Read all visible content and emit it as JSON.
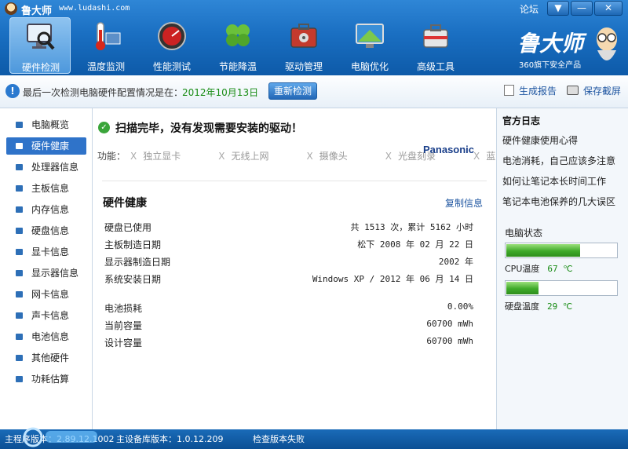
{
  "titlebar": {
    "title": "鲁大师",
    "url": "www.ludashi.com",
    "forum": "论坛",
    "menu_glyph": "▼",
    "min_glyph": "—",
    "close_glyph": "✕"
  },
  "nav": [
    {
      "label": "硬件检测",
      "icon": "monitor-magnifier-icon"
    },
    {
      "label": "温度监测",
      "icon": "thermometer-icon"
    },
    {
      "label": "性能测试",
      "icon": "speedometer-icon"
    },
    {
      "label": "节能降温",
      "icon": "clover-icon"
    },
    {
      "label": "驱动管理",
      "icon": "toolbox-icon"
    },
    {
      "label": "电脑优化",
      "icon": "screen-optimize-icon"
    },
    {
      "label": "高级工具",
      "icon": "toolkit-icon"
    }
  ],
  "brand": {
    "name": "鲁大师",
    "sub": "360旗下安全产品"
  },
  "infobar": {
    "text": "最后一次检测电脑硬件配置情况是在：",
    "date": "2012年10月13日",
    "recheck": "重新检测",
    "report": "生成报告",
    "screenshot": "保存截屏"
  },
  "sidebar": [
    {
      "label": "电脑概览"
    },
    {
      "label": "硬件健康"
    },
    {
      "label": "处理器信息"
    },
    {
      "label": "主板信息"
    },
    {
      "label": "内存信息"
    },
    {
      "label": "硬盘信息"
    },
    {
      "label": "显卡信息"
    },
    {
      "label": "显示器信息"
    },
    {
      "label": "网卡信息"
    },
    {
      "label": "声卡信息"
    },
    {
      "label": "电池信息"
    },
    {
      "label": "其他硬件"
    },
    {
      "label": "功耗估算"
    }
  ],
  "main": {
    "scan_message": "扫描完毕，没有发现需要安装的驱动！",
    "func_label": "功能：",
    "functions": [
      {
        "mark": "X",
        "name": "独立显卡"
      },
      {
        "mark": "X",
        "name": "无线上网"
      },
      {
        "mark": "X",
        "name": "摄像头"
      },
      {
        "mark": "X",
        "name": "光盘刻录"
      },
      {
        "mark": "X",
        "name": "蓝牙"
      }
    ],
    "vendor": "Panasonic",
    "section_title": "硬件健康",
    "copy_link": "复制信息",
    "rows": [
      {
        "key": "硬盘已使用",
        "value": "共 1513 次，累计 5162 小时"
      },
      {
        "key": "主板制造日期",
        "value": "松下 2008 年 02 月 22 日"
      },
      {
        "key": "显示器制造日期",
        "value": "2002 年"
      },
      {
        "key": "系统安装日期",
        "value": "Windows XP / 2012 年 06 月 14 日"
      },
      {
        "key": "电池损耗",
        "value": "0.00%"
      },
      {
        "key": "当前容量",
        "value": "60700 mWh"
      },
      {
        "key": "设计容量",
        "value": "60700 mWh"
      }
    ]
  },
  "rightpanel": {
    "title": "官方日志",
    "links": [
      "硬件健康使用心得",
      "电池消耗，自己应该多注意",
      "如何让笔记本长时间工作",
      "笔记本电池保养的几大误区"
    ],
    "status_title": "电脑状态",
    "cpu_label": "CPU温度",
    "cpu_value": "67 ℃",
    "cpu_level": 0.67,
    "disk_label": "硬盘温度",
    "disk_value": "29 ℃",
    "disk_level": 0.29
  },
  "statusbar": {
    "main_version": "主程序版本：2.89.12.1002",
    "db_version": "主设备库版本：1.0.12.209",
    "check": "检查版本失败"
  },
  "colors": {
    "header": "#1a6fc2",
    "accent": "#2f73c9",
    "ok_green": "#178b13"
  }
}
